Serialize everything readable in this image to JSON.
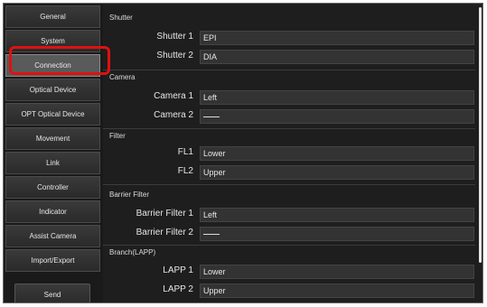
{
  "sidebar": {
    "items": [
      {
        "label": "General"
      },
      {
        "label": "System"
      },
      {
        "label": "Connection"
      },
      {
        "label": "Optical Device"
      },
      {
        "label": "OPT Optical Device"
      },
      {
        "label": "Movement"
      },
      {
        "label": "Link"
      },
      {
        "label": "Controller"
      },
      {
        "label": "Indicator"
      },
      {
        "label": "Assist Camera"
      },
      {
        "label": "Import/Export"
      }
    ],
    "active": "Connection",
    "send_label": "Send"
  },
  "sections": [
    {
      "title": "Shutter",
      "rows": [
        {
          "label": "Shutter 1",
          "value": "EPI"
        },
        {
          "label": "Shutter 2",
          "value": "DIA"
        }
      ]
    },
    {
      "title": "Camera",
      "rows": [
        {
          "label": "Camera 1",
          "value": "Left"
        },
        {
          "label": "Camera 2",
          "value": ""
        }
      ]
    },
    {
      "title": "Filter",
      "rows": [
        {
          "label": "FL1",
          "value": "Lower"
        },
        {
          "label": "FL2",
          "value": "Upper"
        }
      ]
    },
    {
      "title": "Barrier Filter",
      "rows": [
        {
          "label": "Barrier Filter 1",
          "value": "Left"
        },
        {
          "label": "Barrier Filter 2",
          "value": ""
        }
      ]
    },
    {
      "title": "Branch(LAPP)",
      "rows": [
        {
          "label": "LAPP 1",
          "value": "Lower"
        },
        {
          "label": "LAPP 2",
          "value": "Upper"
        }
      ]
    }
  ],
  "colors": {
    "accent_selection": "#e01010",
    "background": "#1a1a1a"
  }
}
